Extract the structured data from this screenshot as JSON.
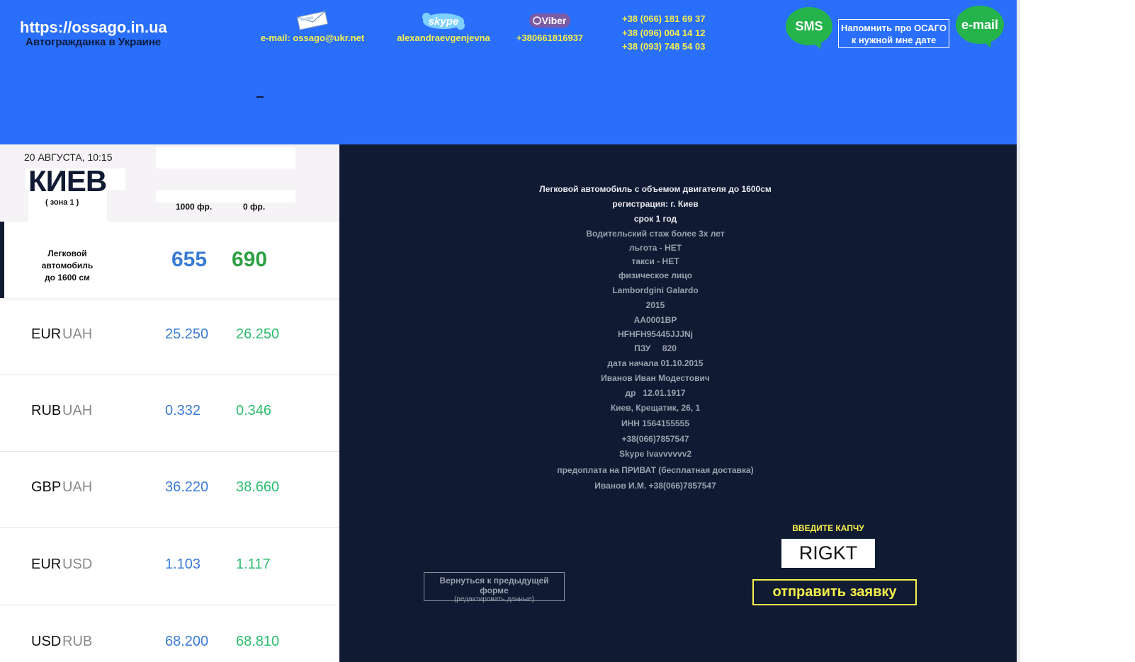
{
  "header": {
    "site_url": "https://ossago.in.ua",
    "tagline": "Автогражданка в Украине",
    "email_contact": "e-mail: ossago@ukr.net",
    "skype_icon_text": "skype",
    "skype_contact": "alexandraevgenjevna",
    "viber_icon_text": "Viber",
    "viber_contact": "+380661816937",
    "phones": [
      "+38 (066) 181 69 37",
      "+38 (096) 004 14 12",
      "+38 (093) 748 54 03"
    ],
    "sms_label": "SMS",
    "remind_label_1": "Напомнить про ОСАГО",
    "remind_label_2": "к нужной мне дате",
    "email_button_label": "e-mail",
    "dash": "-"
  },
  "prices": {
    "date": "20 АВГУСТА, 10:15",
    "city": "КИЕВ",
    "zone": "( зона 1 )",
    "col_1000": "1000 фр.",
    "col_0": "0 фр.",
    "car_label_1": "Легковой автомобиль",
    "car_label_2": "до 1600 см",
    "price_1000": "655",
    "price_0": "690"
  },
  "rates": [
    {
      "from": "EUR",
      "to": "UAH",
      "buy": "25.250",
      "sell": "26.250"
    },
    {
      "from": "RUB",
      "to": "UAH",
      "buy": "0.332",
      "sell": "0.346"
    },
    {
      "from": "GBP",
      "to": "UAH",
      "buy": "36.220",
      "sell": "38.660"
    },
    {
      "from": "EUR",
      "to": "USD",
      "buy": "1.103",
      "sell": "1.117"
    },
    {
      "from": "USD",
      "to": "RUB",
      "buy": "68.200",
      "sell": "68.810"
    }
  ],
  "summary": [
    "Легковой автомобиль с объемом двигателя до 1600см",
    "регистрация: г. Киев",
    "срок 1 год",
    "Водительский стаж более 3х лет",
    "льгота - НЕТ",
    "такси - НЕТ",
    "физическое лицо",
    "Lambordgini Galardo",
    "2015",
    "AA0001BP",
    "HFHFH95445JJJNj",
    "ПЗУ     820",
    "дата начала 01.10.2015",
    "Иванов Иван  Модестович",
    "др   12.01.1917",
    "Киев, Крещатик, 26, 1",
    "ИНН 1564155555",
    "+38(066)7857547",
    "Skype  Ivavvvvvv2",
    "предоплата на ПРИВАТ (бесплатная доставка)",
    "Иванов И.М. +38(066)7857547"
  ],
  "form": {
    "back_label": "Вернуться к предыдущей форме",
    "back_sub": "(редактировать данные)",
    "captcha_label": "ВВЕДИТЕ КАПЧУ",
    "captcha_value": "RIGKT",
    "submit_label": "отправить заявку"
  },
  "colors": {
    "header_bg": "#2a6ffc",
    "panel_dark": "#101b33",
    "accent_yellow": "#f6f04a",
    "bubble_green": "#25b34b",
    "price_blue": "#3a7bd5",
    "price_green": "#2ea043"
  }
}
